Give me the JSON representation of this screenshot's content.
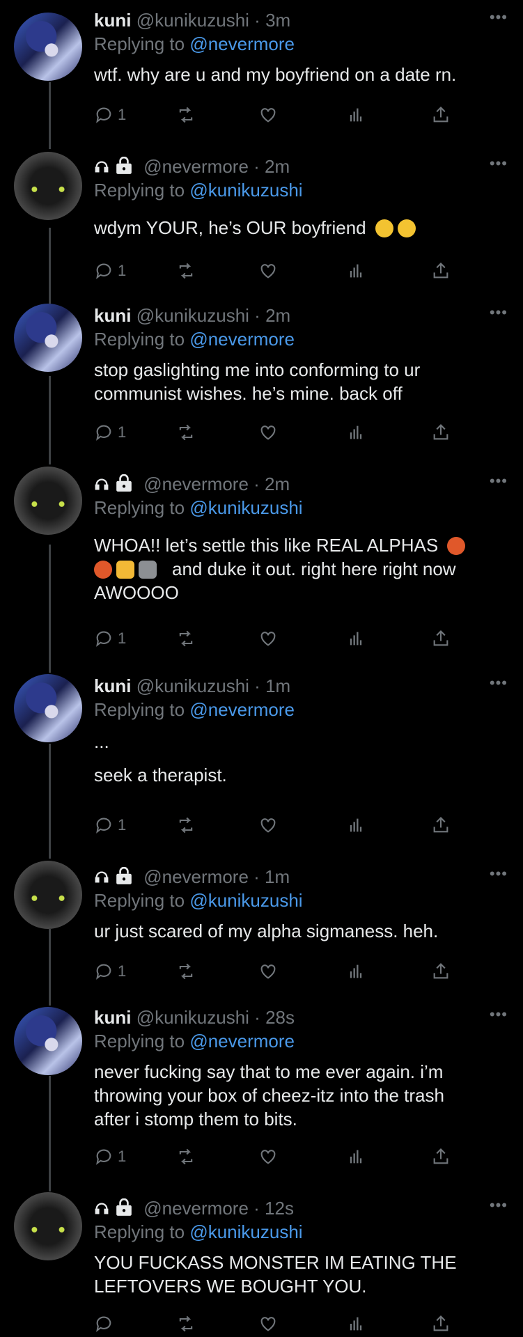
{
  "accounts": {
    "kuni": {
      "display_name": "kuni",
      "handle": "@kunikuzushi"
    },
    "nevermore": {
      "handle": "@nevermore"
    }
  },
  "replying_prefix": "Replying to",
  "tweets": [
    {
      "author": "kuni",
      "name": "kuni",
      "handle": "@kunikuzushi",
      "time": "3m",
      "replying_to": "@nevermore",
      "lines": [
        "wtf. why are u and my boyfriend on a date rn."
      ],
      "reply_count": "1"
    },
    {
      "author": "nevermore",
      "name": "",
      "handle": "@nevermore",
      "time": "2m",
      "replying_to": "@kunikuzushi",
      "lines": [
        "wdym YOUR, he’s OUR boyfriend"
      ],
      "emoji": [
        "rofl-emoji",
        "rofl-emoji"
      ],
      "reply_count": "1"
    },
    {
      "author": "kuni",
      "name": "kuni",
      "handle": "@kunikuzushi",
      "time": "2m",
      "replying_to": "@nevermore",
      "lines": [
        "stop gaslighting me into conforming to ur",
        "communist wishes. he’s mine. back off"
      ],
      "reply_count": "1"
    },
    {
      "author": "nevermore",
      "name": "",
      "handle": "@nevermore",
      "time": "2m",
      "replying_to": "@kunikuzushi",
      "lines": [
        "WHOA!! let’s settle this like REAL ALPHAS",
        "and duke it out. right here right now",
        "AWOOOO"
      ],
      "emoji": [
        "cursing-face-emoji",
        "cursing-face-emoji",
        "flexed-biceps-emoji",
        "wolf-emoji"
      ],
      "reply_count": "1"
    },
    {
      "author": "kuni",
      "name": "kuni",
      "handle": "@kunikuzushi",
      "time": "1m",
      "replying_to": "@nevermore",
      "lines": [
        "...",
        "",
        "seek a therapist."
      ],
      "reply_count": "1"
    },
    {
      "author": "nevermore",
      "name": "",
      "handle": "@nevermore",
      "time": "1m",
      "replying_to": "@kunikuzushi",
      "lines": [
        "ur just scared of my alpha sigmaness. heh."
      ],
      "reply_count": "1"
    },
    {
      "author": "kuni",
      "name": "kuni",
      "handle": "@kunikuzushi",
      "time": "28s",
      "replying_to": "@nevermore",
      "lines": [
        "never fucking say that to me ever again. i’m",
        "throwing your box of cheez-itz into the trash",
        "after i stomp them to bits."
      ],
      "reply_count": "1"
    },
    {
      "author": "nevermore",
      "name": "",
      "handle": "@nevermore",
      "time": "12s",
      "replying_to": "@kunikuzushi",
      "lines": [
        "YOU FUCKASS MONSTER IM EATING THE",
        "LEFTOVERS WE BOUGHT YOU."
      ],
      "reply_count": ""
    }
  ],
  "icons": {
    "more": "more-horizontal-icon",
    "reply": "reply-icon",
    "retweet": "retweet-icon",
    "like": "heart-icon",
    "views": "analytics-icon",
    "share": "share-icon",
    "headphones": "headphones-icon",
    "lock": "lock-icon"
  },
  "colors": {
    "background": "#000000",
    "text": "#e7e9ea",
    "muted": "#71767b",
    "link": "#4a99e9"
  }
}
